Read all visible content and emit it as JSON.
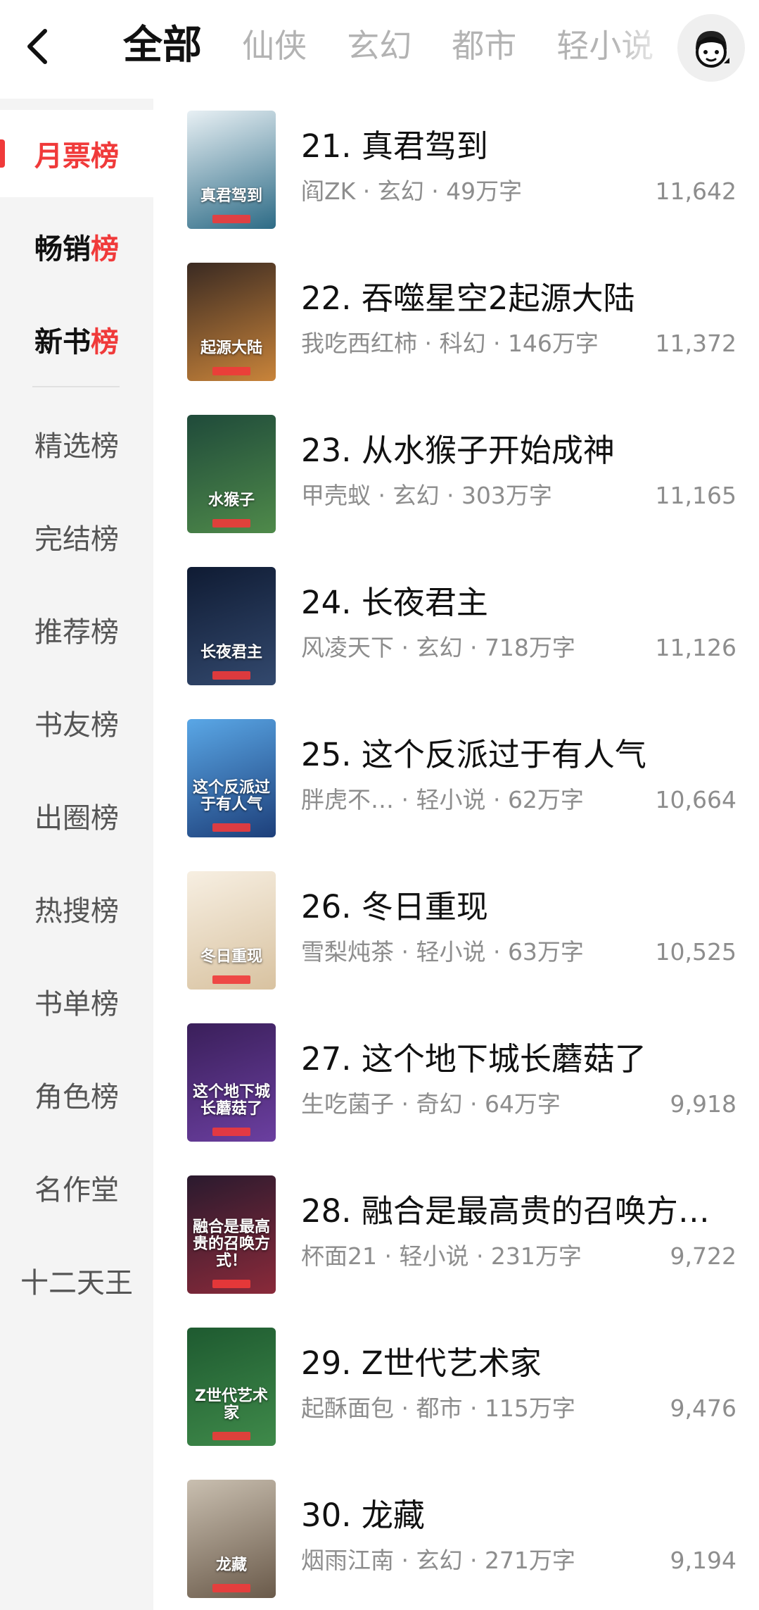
{
  "header": {
    "tabs": [
      {
        "label": "全部",
        "active": true
      },
      {
        "label": "仙侠",
        "active": false
      },
      {
        "label": "玄幻",
        "active": false
      },
      {
        "label": "都市",
        "active": false
      },
      {
        "label": "轻小说",
        "active": false
      }
    ]
  },
  "sidebar": {
    "items": [
      {
        "label": "月票榜",
        "active": true
      },
      {
        "label": "畅销榜",
        "active": false
      },
      {
        "label": "新书榜",
        "active": false
      },
      {
        "label": "精选榜",
        "active": false
      },
      {
        "label": "完结榜",
        "active": false
      },
      {
        "label": "推荐榜",
        "active": false
      },
      {
        "label": "书友榜",
        "active": false
      },
      {
        "label": "出圈榜",
        "active": false
      },
      {
        "label": "热搜榜",
        "active": false
      },
      {
        "label": "书单榜",
        "active": false
      },
      {
        "label": "角色榜",
        "active": false
      },
      {
        "label": "名作堂",
        "active": false
      },
      {
        "label": "十二天王",
        "active": false
      }
    ]
  },
  "books": [
    {
      "title": "21. 真君驾到",
      "meta": "阎ZK · 玄幻 · 49万字",
      "count": "11,642",
      "cover_text": "真君驾到",
      "cover_colors": [
        "#e8f0f4",
        "#2d6b86"
      ]
    },
    {
      "title": "22. 吞噬星空2起源大陆",
      "meta": "我吃西红柿 · 科幻 · 146万字",
      "count": "11,372",
      "cover_text": "起源大陆",
      "cover_colors": [
        "#3a2a22",
        "#c9843a"
      ]
    },
    {
      "title": "23. 从水猴子开始成神",
      "meta": "甲壳蚁 · 玄幻 · 303万字",
      "count": "11,165",
      "cover_text": "水猴子",
      "cover_colors": [
        "#1f4a3a",
        "#4f8a4a"
      ]
    },
    {
      "title": "24. 长夜君主",
      "meta": "风凌天下 · 玄幻 · 718万字",
      "count": "11,126",
      "cover_text": "长夜君主",
      "cover_colors": [
        "#0f1b33",
        "#33496e"
      ]
    },
    {
      "title": "25. 这个反派过于有人气",
      "meta": "胖虎不… · 轻小说 · 62万字",
      "count": "10,664",
      "cover_text": "这个反派过于有人气",
      "cover_colors": [
        "#5aa7e6",
        "#1d3f7a"
      ]
    },
    {
      "title": "26. 冬日重现",
      "meta": "雪梨炖茶 · 轻小说 · 63万字",
      "count": "10,525",
      "cover_text": "冬日重现",
      "cover_colors": [
        "#f7efe2",
        "#d8c2a0"
      ]
    },
    {
      "title": "27. 这个地下城长蘑菇了",
      "meta": "生吃菌子 · 奇幻 · 64万字",
      "count": "9,918",
      "cover_text": "这个地下城长蘑菇了",
      "cover_colors": [
        "#3a1f5a",
        "#6b3fa0"
      ]
    },
    {
      "title": "28. 融合是最高贵的召唤方式！",
      "meta": "杯面21 · 轻小说 · 231万字",
      "count": "9,722",
      "cover_text": "融合是最高贵的召唤方式！",
      "cover_colors": [
        "#2a1a2e",
        "#8a2a3a"
      ]
    },
    {
      "title": "29. Z世代艺术家",
      "meta": "起酥面包 · 都市 · 115万字",
      "count": "9,476",
      "cover_text": "Z世代艺术家",
      "cover_colors": [
        "#1e5a30",
        "#3f8a4a"
      ]
    },
    {
      "title": "30. 龙藏",
      "meta": "烟雨江南 · 玄幻 · 271万字",
      "count": "9,194",
      "cover_text": "龙藏",
      "cover_colors": [
        "#c9bfb0",
        "#6a5a4a"
      ]
    }
  ],
  "colors": {
    "accent": "#f03a3a",
    "sidebar_bg": "#f4f4f4"
  }
}
